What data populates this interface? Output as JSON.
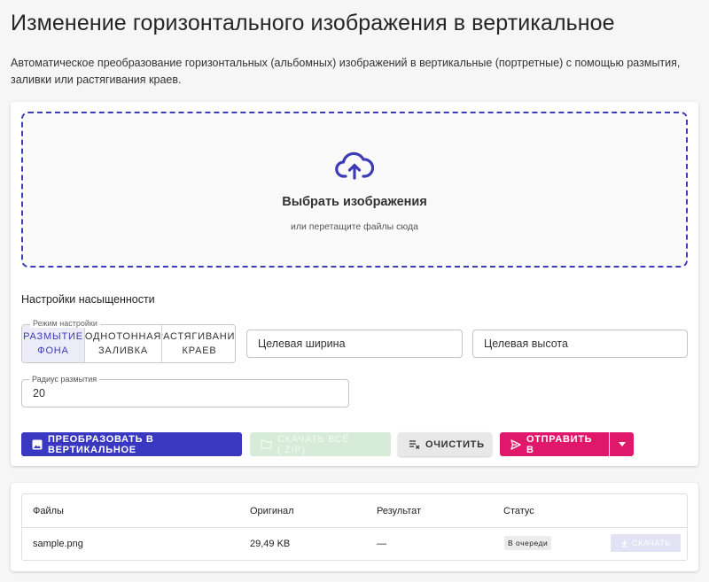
{
  "page": {
    "title": "Изменение горизонтального изображения в вертикальное",
    "description": "Автоматическое преобразование горизонтальных (альбомных) изображений в вертикальные (портретные) с помощью размытия, заливки или растягивания краев."
  },
  "dropzone": {
    "title": "Выбрать изображения",
    "subtitle": "или перетащите файлы сюда",
    "icon": "cloud-upload-icon"
  },
  "settings": {
    "title": "Настройки насыщенности",
    "mode_label": "Режим настройки",
    "modes": [
      {
        "label": "Размытие\nфона",
        "active": true
      },
      {
        "label": "Однотонная\nзаливка",
        "active": false
      },
      {
        "label": "Растягивание\nкраев",
        "active": false
      }
    ],
    "target_width_placeholder": "Целевая ширина",
    "target_height_placeholder": "Целевая высота",
    "blur_radius_label": "Радиус размытия",
    "blur_radius_value": "20"
  },
  "actions": {
    "convert_label": "Преобразовать в вертикальное",
    "download_zip_label": "Скачать всё (.zip)",
    "clear_label": "Очистить",
    "send_label": "Отправить в"
  },
  "table": {
    "headers": [
      "Файлы",
      "Оригинал",
      "Результат",
      "Статус"
    ],
    "rows": [
      {
        "file": "sample.png",
        "original": "29,49 KB",
        "result": "—",
        "status": "В очереди",
        "download_label": "Скачать"
      }
    ]
  },
  "colors": {
    "primary": "#3a37c0",
    "accent": "#e0186c",
    "zip_disabled": "#d6ecd8",
    "download_disabled": "#e2e2f4"
  }
}
